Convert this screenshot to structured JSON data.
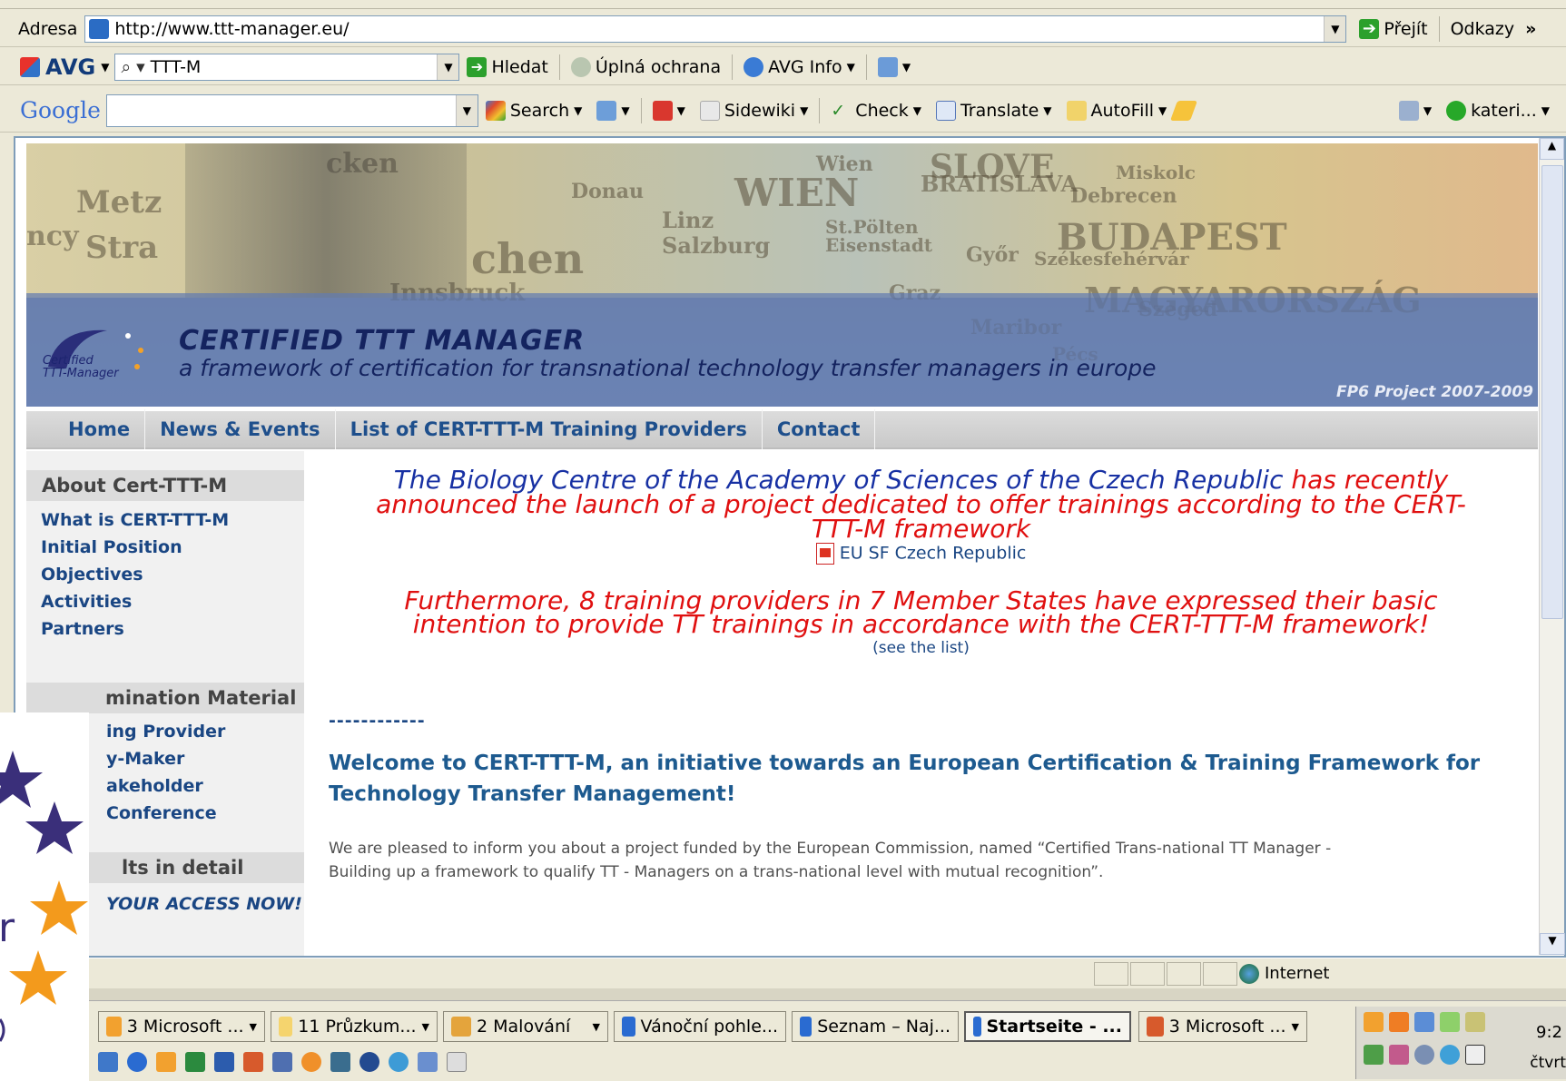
{
  "address_bar": {
    "label": "Adresa",
    "url": "http://www.ttt-manager.eu/",
    "go_label": "Přejít",
    "links_label": "Odkazy",
    "chevron": "»"
  },
  "avg_bar": {
    "brand": "AVG",
    "search_value": "TTT-M",
    "search_label": "Hledat",
    "protection_label": "Úplná ochrana",
    "info_label": "AVG Info"
  },
  "google_bar": {
    "brand": "Google",
    "search_label": "Search",
    "sidewiki_label": "Sidewiki",
    "check_label": "Check",
    "translate_label": "Translate",
    "autofill_label": "AutoFill",
    "account_label": "kateri..."
  },
  "banner": {
    "map_words": [
      "Metz",
      "Stra",
      "ncy",
      "cken",
      "Donau",
      "WIEN",
      "BRATISLAVA",
      "SLOVE",
      "BUDAPEST",
      "Debrecen",
      "Linz",
      "Salzburg",
      "St.Pölten",
      "Eisenstadt",
      "Győr",
      "Székesfehérvár",
      "Graz",
      "MAGYARORSZÁG",
      "Szeged",
      "Pécs",
      "Maribor",
      "Innsbruck",
      "chen",
      "Wien",
      "Miskolc"
    ],
    "logo_text_1": "Certified",
    "logo_text_2": "TTT-Manager",
    "title": "CERTIFIED TTT MANAGER",
    "subtitle": "a framework of certification for transnational technology transfer managers in europe",
    "project": "FP6 Project 2007-2009"
  },
  "nav": [
    "Home",
    "News & Events",
    "List of CERT-TTT-M Training Providers",
    "Contact"
  ],
  "sidebar": {
    "about_heading": "About Cert-TTT-M",
    "about_links": [
      "What is CERT-TTT-M",
      "Initial Position",
      "Objectives",
      "Activities",
      "Partners"
    ],
    "dissemination_heading": "mination Material",
    "dissemination_links": [
      "ing Provider",
      "y-Maker",
      "akeholder",
      "Conference"
    ],
    "results_heading": "lts in detail",
    "results_link": "YOUR ACCESS NOW!"
  },
  "content": {
    "announce_blue": "The Biology Centre of the Academy of Sciences of the Czech Republic",
    "announce_red_1": "has recently",
    "announce_red_2": "announced the launch of a project dedicated to offer trainings according to the CERT-",
    "announce_red_3": "TTT-M framework",
    "pdf_link": "EU SF Czech Republic",
    "furthermore_1": "Furthermore, 8 training providers in 7 Member States have expressed their basic",
    "furthermore_2": "intention to provide TT trainings in accordance with the CERT-TTT-M framework!",
    "see_list": "(see the list)",
    "dashes": "------------",
    "welcome_1": "Welcome to CERT-TTT-M, an initiative towards an European Certification & Training Framework for",
    "welcome_2": "Technology Transfer Management!",
    "body_1": "We are pleased to inform you about a project funded by the European Commission, named “Certified Trans-national TT Manager -",
    "body_2": "Building up a framework to qualify TT - Managers on a trans-national level with mutual recognition”."
  },
  "status_bar": {
    "zone": "Internet"
  },
  "taskbar": {
    "buttons": [
      "3 Microsoft ...",
      "11 Průzkum...",
      "2 Malování",
      "Vánoční pohle...",
      "Seznam – Naj...",
      "Startseite - ...",
      "3 Microsoft ..."
    ],
    "tray_time": "9:2",
    "tray_day": "čtvrt",
    "overlay_letter": "r"
  },
  "colors": {
    "brand_blue": "#1730a3",
    "alert_red": "#e01010",
    "nav_blue": "#1e4f8c",
    "star_purple": "#3a2f7a",
    "star_orange": "#f39a1c"
  }
}
